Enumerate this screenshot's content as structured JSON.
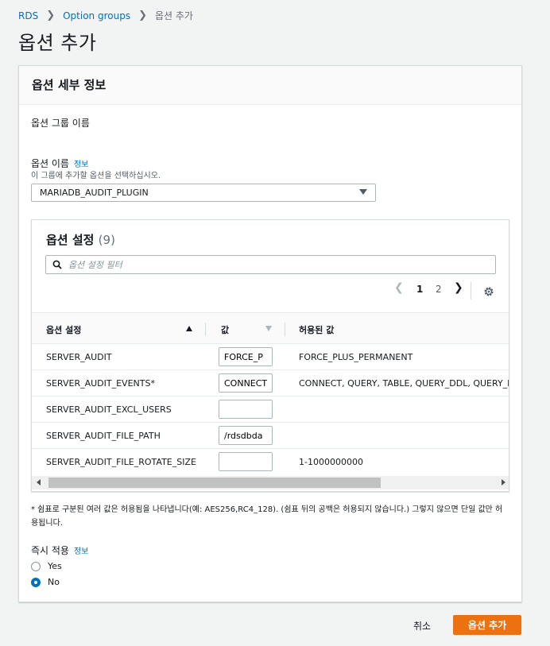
{
  "breadcrumb": {
    "items": [
      "RDS",
      "Option groups",
      "옵션 추가"
    ]
  },
  "page": {
    "title": "옵션 추가"
  },
  "panel": {
    "title": "옵션 세부 정보",
    "group_name_label": "옵션 그룹 이름",
    "option_name_label": "옵션 이름",
    "info_link": "정보",
    "option_name_desc": "이 그룹에 추가할 옵션을 선택하십시오.",
    "option_name_value": "MARIADB_AUDIT_PLUGIN"
  },
  "settings": {
    "title": "옵션 설정",
    "count": "(9)",
    "filter_placeholder": "옵션 설정 필터",
    "pager": {
      "page1": "1",
      "page2": "2"
    },
    "columns": [
      "옵션 설정",
      "값",
      "허용된 값"
    ],
    "rows": [
      {
        "name": "SERVER_AUDIT",
        "value": "FORCE_P",
        "allowed": "FORCE_PLUS_PERMANENT"
      },
      {
        "name": "SERVER_AUDIT_EVENTS*",
        "value": "CONNECT",
        "allowed": "CONNECT, QUERY, TABLE, QUERY_DDL, QUERY_D"
      },
      {
        "name": "SERVER_AUDIT_EXCL_USERS",
        "value": "",
        "allowed": ""
      },
      {
        "name": "SERVER_AUDIT_FILE_PATH",
        "value": "/rdsdbda",
        "allowed": ""
      },
      {
        "name": "SERVER_AUDIT_FILE_ROTATE_SIZE",
        "value": "",
        "allowed": "1-1000000000"
      }
    ]
  },
  "note": "* 쉼표로 구분된 여러 값은 허용됨을 나타냅니다(예: AES256,RC4_128). (쉼표 뒤의 공백은 허용되지 않습니다.) 그렇지 않으면 단일 값만 허용됩니다.",
  "apply": {
    "label": "즉시 적용",
    "info_link": "정보",
    "yes": "Yes",
    "no": "No",
    "selected": "No"
  },
  "footer": {
    "cancel": "취소",
    "submit": "옵션 추가"
  },
  "colors": {
    "accent": "#ec7211",
    "link": "#0073bb",
    "radio_selected": "#0073bb"
  },
  "icons": [
    "search-icon",
    "chevron-left-icon",
    "chevron-right-icon",
    "gear-icon",
    "sort-ascending-icon",
    "sort-descending-icon",
    "dropdown-caret-icon"
  ]
}
